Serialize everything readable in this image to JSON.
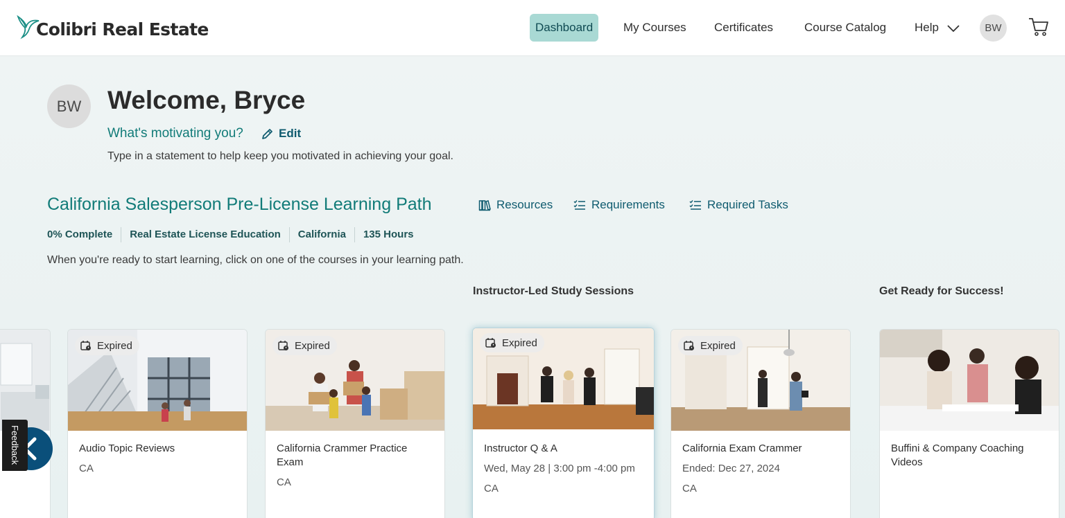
{
  "header": {
    "logo_text": "Colibri Real Estate",
    "nav": {
      "dashboard": "Dashboard",
      "my_courses": "My Courses",
      "certificates": "Certificates",
      "course_catalog": "Course Catalog",
      "help": "Help"
    },
    "avatar_initials": "BW",
    "cart_icon": "cart-icon"
  },
  "profile": {
    "avatar_initials": "BW",
    "welcome": "Welcome, Bryce",
    "motivation_label": "What's motivating you?",
    "edit_label": "Edit",
    "motivation_hint": "Type in a statement to help keep you motivated in achieving your goal."
  },
  "learning_path": {
    "title": "California Salesperson Pre-License Learning Path",
    "links": {
      "resources": "Resources",
      "requirements": "Requirements",
      "required_tasks": "Required Tasks"
    },
    "meta": [
      "0% Complete",
      "Real Estate License Education",
      "California",
      "135 Hours"
    ],
    "hint": "When you're ready to start learning, click on one of the courses in your learning path."
  },
  "sections": {
    "instructor_led": "Instructor-Led Study Sessions",
    "get_ready": "Get Ready for Success!"
  },
  "cards": [
    {
      "badge": "Expired",
      "title": "Audio Topic Reviews",
      "sub": "CA",
      "sub2": ""
    },
    {
      "badge": "Expired",
      "title": "California Crammer Practice Exam",
      "sub": "CA",
      "sub2": ""
    },
    {
      "badge": "Expired",
      "title": "Instructor Q & A",
      "sub": "Wed, May 28 | 3:00 pm -4:00 pm",
      "sub2": "CA"
    },
    {
      "badge": "Expired",
      "title": "California Exam Crammer",
      "sub": "Ended: Dec 27, 2024",
      "sub2": "CA"
    },
    {
      "badge": "",
      "title": "Buffini & Company Coaching Videos",
      "sub": "",
      "sub2": ""
    }
  ],
  "feedback_label": "Feedback",
  "colors": {
    "accent_teal": "#117b78",
    "nav_active_bg": "#a9d9d4",
    "link_blue": "#0f5b6f",
    "carousel_button": "#0a4f7a"
  }
}
